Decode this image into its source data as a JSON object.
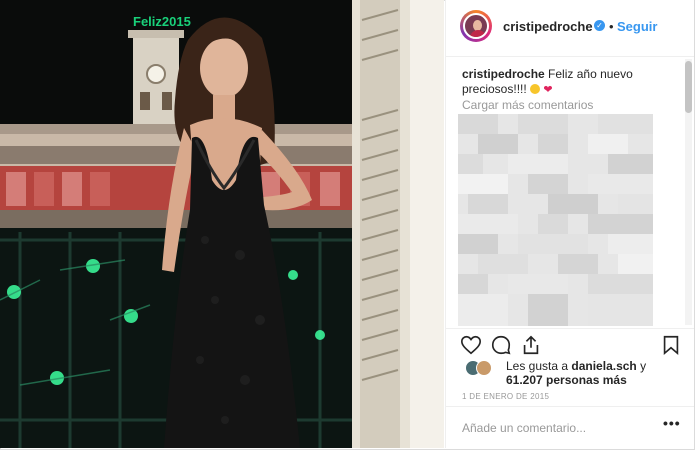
{
  "post": {
    "username": "cristipedroche",
    "verified_icon": "verified-badge-icon",
    "separator": "•",
    "follow_label": "Seguir",
    "caption_user": "cristipedroche",
    "caption_text": "Feliz año nuevo preciosos!!!!",
    "load_more_label": "Cargar más comentarios",
    "likes_prefix": "Les gusta a ",
    "likes_user": "daniela.sch",
    "likes_connector": " y",
    "likes_count": "61.207 personas más",
    "date": "1 DE ENERO DE 2015",
    "add_comment_placeholder": "Añade un comentario...",
    "more_label": "•••"
  },
  "photo": {
    "clock_sign": "Feliz2015"
  },
  "colors": {
    "accent": "#3897f0",
    "text": "#262626",
    "muted": "#999999",
    "heart": "#e0245e"
  },
  "icons": [
    "like-heart-icon",
    "comment-icon",
    "share-icon",
    "save-bookmark-icon"
  ]
}
